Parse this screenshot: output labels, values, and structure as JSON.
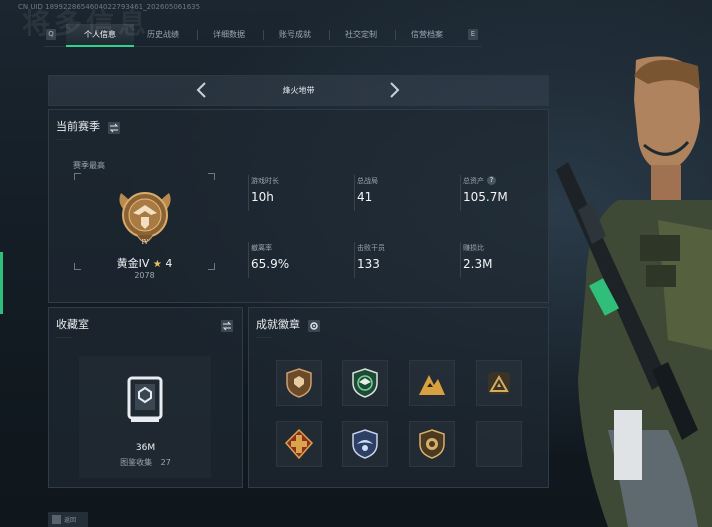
{
  "header": {
    "background_title": "将多信息",
    "uid_text": "CN UID 1899228654604022793461_202605061635"
  },
  "tabs": {
    "key_left": "Q",
    "key_right": "E",
    "items": [
      {
        "label": "个人信息",
        "active": true
      },
      {
        "label": "历史战绩",
        "active": false
      },
      {
        "label": "详细数据",
        "active": false
      },
      {
        "label": "账号成就",
        "active": false
      },
      {
        "label": "社交定制",
        "active": false
      },
      {
        "label": "信营档案",
        "active": false
      }
    ]
  },
  "mode_selector": {
    "label": "烽火地带"
  },
  "season": {
    "title": "当前赛季",
    "best_label": "赛季最高",
    "rank_name": "黄金IV",
    "rank_stars": "4",
    "rank_score": "2078",
    "stats": [
      {
        "label": "游戏时长",
        "value": "10h"
      },
      {
        "label": "总战局",
        "value": "41"
      },
      {
        "label": "总资产",
        "value": "105.7M",
        "help": "?"
      },
      {
        "label": "撤离率",
        "value": "65.9%"
      },
      {
        "label": "击败干员",
        "value": "133"
      },
      {
        "label": "赚损比",
        "value": "2.3M"
      }
    ]
  },
  "collection": {
    "title": "收藏室",
    "value": "36M",
    "sub_label": "图鉴收集",
    "sub_value": "27"
  },
  "achievements": {
    "title": "成就徽章",
    "badges": [
      {
        "icon": "bronze-shield-emblem-icon"
      },
      {
        "icon": "green-eagle-shield-icon"
      },
      {
        "icon": "gold-mountain-icon"
      },
      {
        "icon": "gold-triangle-icon"
      },
      {
        "icon": "red-gold-cross-icon"
      },
      {
        "icon": "blue-wing-shield-icon"
      },
      {
        "icon": "gold-medal-shield-icon"
      },
      {
        "icon": "empty-slot"
      }
    ]
  },
  "footer": {
    "hint_label": "返回"
  },
  "colors": {
    "accent": "#2fd38a",
    "gold": "#c99a52",
    "panel": "#1e2832"
  }
}
